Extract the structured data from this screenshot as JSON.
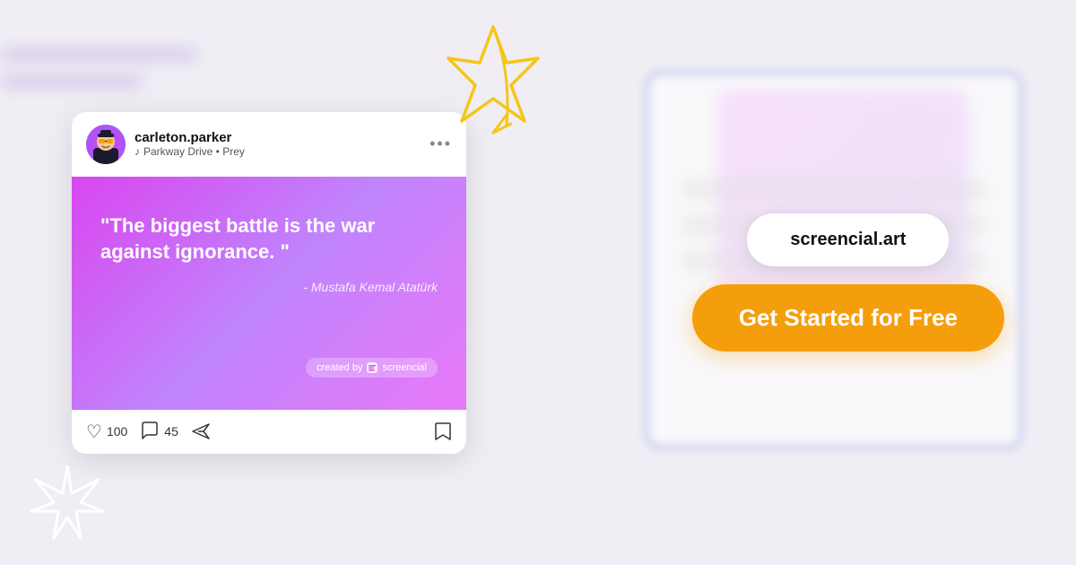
{
  "background": {
    "colors": {
      "main": "#f0eef4",
      "accent_purple": "#c084fc",
      "accent_pink": "#e879f9",
      "accent_blue": "#6b85e0"
    }
  },
  "post": {
    "username": "carleton.parker",
    "song_label": "Parkway Drive • Prey",
    "music_icon": "♪",
    "more_icon": "•••",
    "quote": "\"The biggest battle is the war against ignorance. \"",
    "attribution": "- Mustafa Kemal Atatürk",
    "created_by": "created by",
    "brand_name": "screencial",
    "likes_count": "100",
    "comments_count": "45",
    "heart_icon": "♡",
    "comment_icon": "○",
    "send_icon": "➤",
    "bookmark_icon": "⊟"
  },
  "cta": {
    "url_label": "screencial.art",
    "button_label": "Get Started for Free",
    "button_color": "#f59e0b"
  }
}
